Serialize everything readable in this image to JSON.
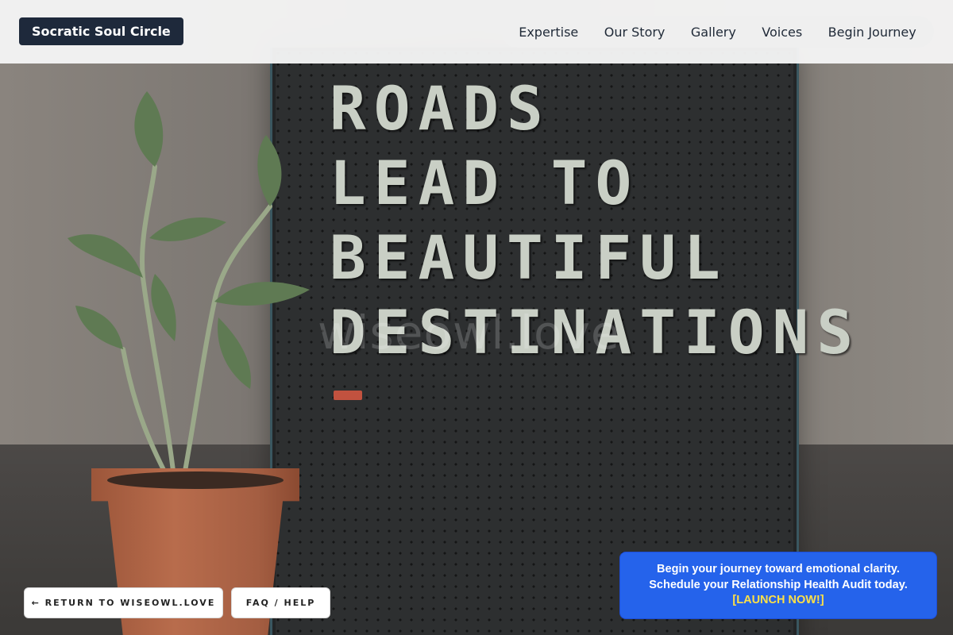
{
  "header": {
    "brand": "Socratic Soul Circle",
    "nav": [
      "Expertise",
      "Our Story",
      "Gallery",
      "Voices",
      "Begin Journey"
    ]
  },
  "hero": {
    "board_lines": [
      "ROADS",
      "LEAD TO",
      "BEAUTIFUL",
      "DESTINATIONS"
    ],
    "watermark": "wiseowl.love"
  },
  "buttons": {
    "return_label": "← RETURN TO WISEOWL.LOVE",
    "faq_label": "FAQ / HELP"
  },
  "cta": {
    "line1": "Begin your journey toward emotional clarity.",
    "line2": "Schedule your Relationship Health Audit today.",
    "launch": "[LAUNCH NOW!]"
  },
  "colors": {
    "brand_bg": "#1e293b",
    "cta_bg": "#2563eb",
    "cta_link": "#fde047"
  }
}
